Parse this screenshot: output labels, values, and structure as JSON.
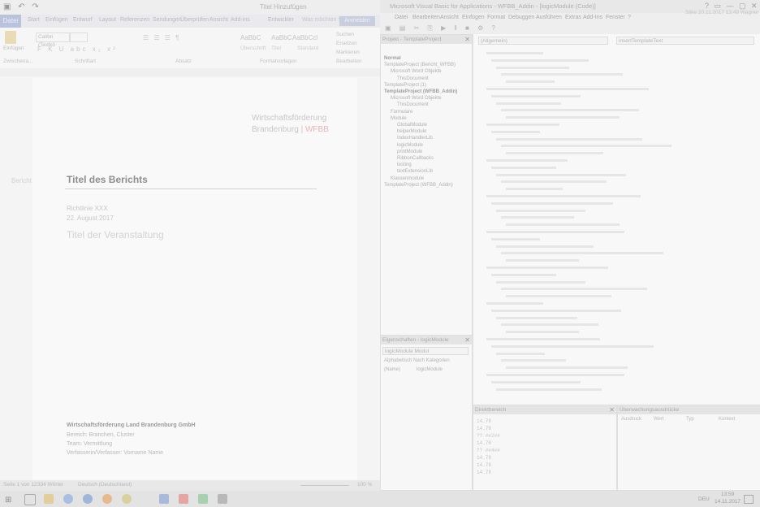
{
  "word": {
    "title": "Titel Hinzufügen",
    "qa_icons": "▣ ↶ ↷",
    "file_tab": "Datei",
    "tabs": [
      "Start",
      "Einfügen",
      "Entwurf",
      "Layout",
      "Referenzen",
      "Sendungen",
      "Überprüfen",
      "Ansicht",
      "Add-ins",
      "Entwickler",
      "Was möchten Sie tun?"
    ],
    "help_button": "Anmelden",
    "paste_label": "Einfügen",
    "font_name": "Calibri (Textkö",
    "style_previews": [
      "AaBbC",
      "AaBbC",
      "AaBbCcl"
    ],
    "style_names": [
      "Überschrift",
      "Titel",
      "Standard"
    ],
    "find_items": [
      "Suchen",
      "Ersetzen",
      "Markieren"
    ],
    "group_labels": [
      "Zwischena...",
      "Schriftart",
      "Absatz",
      "Formatvorlagen",
      "Bearbeiten"
    ],
    "logo_line1": "Wirtschaftsförderung",
    "logo_line2_a": "Brandenburg | ",
    "logo_line2_b": "WFBB",
    "doc_title": "Titel des Berichts",
    "doc_side": "Bericht",
    "subtitle1": "Richtlinie XXX",
    "subtitle2": "22. August 2017",
    "big_heading": "Titel der Veranstaltung",
    "footer_bold": "Wirtschaftsförderung Land Brandenburg GmbH",
    "footer_lines": [
      "Bereich: Branchen, Cluster",
      "Team: Vermittlung",
      "Verfasserin/Verfasser: Vorname Name"
    ],
    "status": {
      "page": "Seite 1 von 12",
      "words": "334 Wörter",
      "lang": "Deutsch (Deutschland)",
      "zoom": "100 %"
    }
  },
  "vbe": {
    "title": "Microsoft Visual Basic for Applications - WFBB_Addin - [logicModule (Code)]",
    "menu": [
      "Datei",
      "Bearbeiten",
      "Ansicht",
      "Einfügen",
      "Format",
      "Debuggen",
      "Ausführen",
      "Extras",
      "Add-Ins",
      "Fenster",
      "?"
    ],
    "project_header": "Projekt - TemplateProject",
    "tree": [
      {
        "label": "Normal",
        "bold": true,
        "indent": 0
      },
      {
        "label": "TemplateProject (Bericht_WFBB)",
        "bold": false,
        "indent": 0
      },
      {
        "label": "Microsoft Word Objekte",
        "bold": false,
        "indent": 1
      },
      {
        "label": "ThisDocument",
        "bold": false,
        "indent": 2
      },
      {
        "label": "TemplateProject (1)",
        "bold": false,
        "indent": 0
      },
      {
        "label": "TemplateProject (WFBB_Addin)",
        "bold": true,
        "indent": 0
      },
      {
        "label": "Microsoft Word Objekte",
        "bold": false,
        "indent": 1
      },
      {
        "label": "ThisDocument",
        "bold": false,
        "indent": 2
      },
      {
        "label": "Formulare",
        "bold": false,
        "indent": 1
      },
      {
        "label": "Module",
        "bold": false,
        "indent": 1
      },
      {
        "label": "GlobalModule",
        "bold": false,
        "indent": 2
      },
      {
        "label": "helperModule",
        "bold": false,
        "indent": 2
      },
      {
        "label": "IndexHandlerLib",
        "bold": false,
        "indent": 2
      },
      {
        "label": "logicModule",
        "bold": false,
        "indent": 2
      },
      {
        "label": "printModule",
        "bold": false,
        "indent": 2
      },
      {
        "label": "RibbonCallbacks",
        "bold": false,
        "indent": 2
      },
      {
        "label": "testing",
        "bold": false,
        "indent": 2
      },
      {
        "label": "textExtensionLib",
        "bold": false,
        "indent": 2
      },
      {
        "label": "Klassenmodule",
        "bold": false,
        "indent": 1
      },
      {
        "label": "TemplateProject (WFBB_Addin)",
        "bold": false,
        "indent": 0
      }
    ],
    "props_header": "Eigenschaften - logicModule",
    "props_combo": "logicModule Modul",
    "props_tabs": [
      "Alphabetisch",
      "Nach Kategorien"
    ],
    "props_row": {
      "name": "(Name)",
      "value": "logicModule"
    },
    "combo_left": "(Allgemein)",
    "combo_right": "insertTemplateText",
    "immediate_header": "Direktbereich",
    "immediate_lines": [
      "14.78",
      "14.78",
      "?? ##2##",
      "14.78",
      "?? ##4##",
      "14.78",
      "14.78",
      "14.78"
    ],
    "watch_header": "Überwachungsausdrücke",
    "watch_cols": [
      "Ausdruck",
      "Wert",
      "Typ",
      "Kontext"
    ]
  },
  "taskbar": {
    "tray_lang": "DEU",
    "time": "13:59",
    "date": "14.11.2017",
    "start_glyph": "⊞"
  },
  "topright": {
    "text": "Silke 20.11.2017 13:49 Wagner",
    "buttons": "?  ▭  —  ▢  ✕"
  },
  "colors": {
    "accent": "#b9c3dc",
    "red": "#e8b6b6"
  }
}
